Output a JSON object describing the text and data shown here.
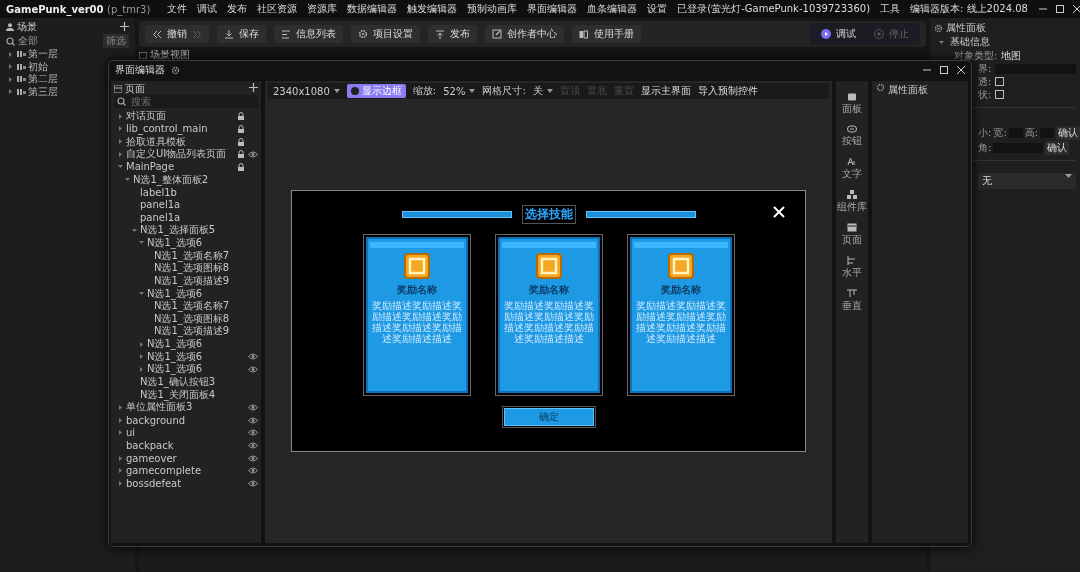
{
  "app": {
    "title": "GamePunk_ver00",
    "project": "(p_tmr3)"
  },
  "menu": [
    "文件",
    "调试",
    "发布",
    "社区资源",
    "资源库",
    "数据编辑器",
    "触发编辑器",
    "预制动画库",
    "界面编辑器",
    "血条编辑器",
    "设置",
    "已登录(萤光灯-GamePunk-1039723360)",
    "工具",
    "编辑器版本: 线上2024.08"
  ],
  "scene_panel": {
    "title": "场景",
    "search": {
      "value": "全部"
    },
    "filter_button": "筛选",
    "items": [
      {
        "label": "第一层",
        "expanded": false
      },
      {
        "label": "初始",
        "expanded": false
      },
      {
        "label": "第二层",
        "expanded": false
      },
      {
        "label": "第三层",
        "expanded": false
      }
    ]
  },
  "toolbar": {
    "buttons": [
      {
        "kind": "undo",
        "label": "撤销"
      },
      {
        "kind": "save",
        "label": "保存"
      },
      {
        "kind": "list",
        "label": "信息列表"
      },
      {
        "kind": "settings",
        "label": "项目设置"
      },
      {
        "kind": "publish",
        "label": "发布"
      },
      {
        "kind": "edit",
        "label": "创作者中心"
      },
      {
        "kind": "book",
        "label": "使用手册"
      }
    ],
    "run": {
      "label": "调试",
      "disabled": false
    },
    "stop": {
      "label": "停止",
      "disabled": true
    }
  },
  "scene_view": {
    "title": "场景视图"
  },
  "properties": {
    "title": "属性面板",
    "section": {
      "title": "基础信息",
      "expanded": true
    },
    "object_type_label": "对象类型:",
    "object_type": "地图",
    "rows": [
      {
        "kind": "field",
        "label": "界:"
      },
      {
        "kind": "checkbox",
        "label": "透:",
        "checked": false
      },
      {
        "kind": "checkbox",
        "label": "状:",
        "checked": false
      }
    ],
    "size_row": {
      "label": "小:",
      "width_label": "宽:",
      "height_label": "高:",
      "button": "确认"
    },
    "angle_row": {
      "label": "角:",
      "button": "确认"
    },
    "dropdown": {
      "value": "无"
    }
  },
  "ui_editor": {
    "title": "界面编辑器",
    "pages": {
      "title": "页面",
      "search": {
        "placeholder": "搜索"
      },
      "tree": [
        {
          "label": "对话页面",
          "expanded": false,
          "locked": true,
          "visible": false
        },
        {
          "label": "lib_control_main",
          "expanded": false,
          "locked": true,
          "visible": false
        },
        {
          "label": "拾取道具模板",
          "expanded": false,
          "locked": true,
          "visible": false
        },
        {
          "label": "自定义UI物品列表页面",
          "expanded": false,
          "locked": true,
          "visible": true
        },
        {
          "label": "MainPage",
          "expanded": true,
          "locked": true,
          "visible": false,
          "children": [
            {
              "label": "N选1_整体面板2",
              "expanded": true,
              "locked": false,
              "visible": false,
              "children": [
                {
                  "label": "label1b",
                  "locked": false,
                  "visible": false
                },
                {
                  "label": "panel1a",
                  "locked": false,
                  "visible": false
                },
                {
                  "label": "panel1a",
                  "locked": false,
                  "visible": false
                },
                {
                  "label": "N选1_选择面板5",
                  "expanded": true,
                  "locked": false,
                  "visible": false,
                  "children": [
                    {
                      "label": "N选1_选项6",
                      "expanded": true,
                      "locked": false,
                      "visible": false,
                      "children": [
                        {
                          "label": "N选1_选项名称7",
                          "locked": false,
                          "visible": false
                        },
                        {
                          "label": "N选1_选项图标8",
                          "locked": false,
                          "visible": false
                        },
                        {
                          "label": "N选1_选项描述9",
                          "locked": false,
                          "visible": false
                        }
                      ]
                    },
                    {
                      "label": "N选1_选项6",
                      "expanded": true,
                      "locked": false,
                      "visible": false,
                      "children": [
                        {
                          "label": "N选1_选项名称7",
                          "locked": false,
                          "visible": false
                        },
                        {
                          "label": "N选1_选项图标8",
                          "locked": false,
                          "visible": false
                        },
                        {
                          "label": "N选1_选项描述9",
                          "locked": false,
                          "visible": false
                        }
                      ]
                    },
                    {
                      "label": "N选1_选项6",
                      "expanded": false,
                      "locked": false,
                      "visible": false
                    },
                    {
                      "label": "N选1_选项6",
                      "expanded": false,
                      "locked": false,
                      "visible": true
                    },
                    {
                      "label": "N选1_选项6",
                      "expanded": false,
                      "locked": false,
                      "visible": true
                    }
                  ]
                },
                {
                  "label": "N选1_确认按钮3",
                  "locked": false,
                  "visible": false
                },
                {
                  "label": "N选1_关闭面板4",
                  "locked": false,
                  "visible": false
                }
              ]
            }
          ]
        },
        {
          "label": "单位属性面板3",
          "expanded": false,
          "locked": false,
          "visible": true
        },
        {
          "label": "background",
          "expanded": false,
          "locked": false,
          "visible": true
        },
        {
          "label": "ui",
          "expanded": false,
          "locked": false,
          "visible": true
        },
        {
          "label": "backpack",
          "locked": false,
          "visible": true
        },
        {
          "label": "gameover",
          "expanded": false,
          "locked": false,
          "visible": true
        },
        {
          "label": "gamecomplete",
          "expanded": false,
          "locked": false,
          "visible": true
        },
        {
          "label": "bossdefeat",
          "expanded": false,
          "locked": false,
          "visible": true
        }
      ]
    },
    "toolbar": {
      "resolution": "2340x1080",
      "show_border": {
        "label": "显示边框",
        "on": true
      },
      "zoom_label": "缩放:",
      "zoom": "52%",
      "grid_label": "网格尺寸:",
      "grid": "关",
      "actions": [
        {
          "label": "置顶",
          "disabled": true
        },
        {
          "label": "置底",
          "disabled": true
        },
        {
          "label": "重置",
          "disabled": true
        },
        {
          "label": "显示主界面",
          "disabled": false
        },
        {
          "label": "导入预制控件",
          "disabled": false
        }
      ]
    },
    "preview": {
      "title": "选择技能",
      "cards": [
        {
          "name": "奖励名称",
          "description": "奖励描述奖励描述奖励描述奖励描述奖励描述奖励描述奖励描述奖励描述描述"
        },
        {
          "name": "奖励名称",
          "description": "奖励描述奖励描述奖励描述奖励描述奖励描述奖励描述奖励描述奖励描述描述"
        },
        {
          "name": "奖励名称",
          "description": "奖励描述奖励描述奖励描述奖励描述奖励描述奖励描述奖励描述奖励描述描述"
        }
      ],
      "confirm": "确定"
    },
    "tools": [
      {
        "kind": "panel",
        "label": "面板"
      },
      {
        "kind": "button",
        "label": "按钮"
      },
      {
        "kind": "text",
        "label": "文字"
      },
      {
        "kind": "library",
        "label": "组件库"
      },
      {
        "kind": "page",
        "label": "页面"
      },
      {
        "kind": "horizontal",
        "label": "水平"
      },
      {
        "kind": "vertical",
        "label": "垂直"
      }
    ],
    "properties": {
      "title": "属性面板"
    }
  }
}
